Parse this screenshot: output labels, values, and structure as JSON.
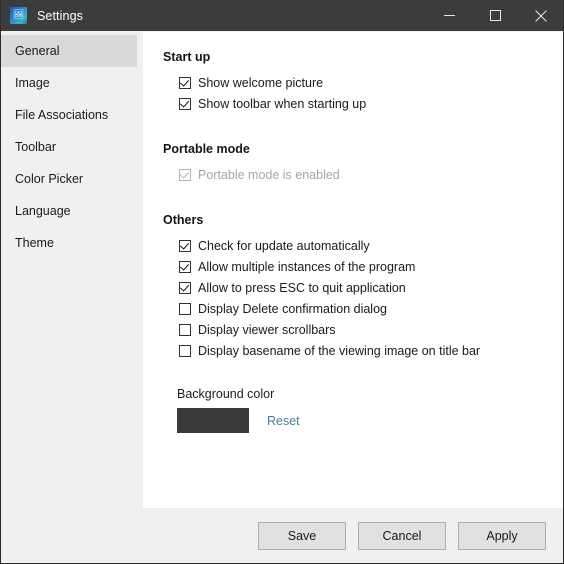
{
  "window": {
    "title": "Settings",
    "app_icon": "image-viewer-icon",
    "controls": {
      "minimize": "minimize-icon",
      "maximize": "maximize-icon",
      "close": "close-icon"
    },
    "titlebar_color": "#3c3c3c"
  },
  "sidebar": {
    "items": [
      {
        "label": "General",
        "selected": true
      },
      {
        "label": "Image",
        "selected": false
      },
      {
        "label": "File Associations",
        "selected": false
      },
      {
        "label": "Toolbar",
        "selected": false
      },
      {
        "label": "Color Picker",
        "selected": false
      },
      {
        "label": "Language",
        "selected": false
      },
      {
        "label": "Theme",
        "selected": false
      }
    ],
    "selected_color": "#d9d9d9",
    "background_color": "#f0f0f0"
  },
  "main": {
    "groups": [
      {
        "title": "Start up",
        "options": [
          {
            "label": "Show welcome picture",
            "checked": true,
            "disabled": false
          },
          {
            "label": "Show toolbar when starting up",
            "checked": true,
            "disabled": false
          }
        ]
      },
      {
        "title": "Portable mode",
        "options": [
          {
            "label": "Portable mode is enabled",
            "checked": true,
            "disabled": true
          }
        ]
      },
      {
        "title": "Others",
        "options": [
          {
            "label": "Check for update automatically",
            "checked": true,
            "disabled": false
          },
          {
            "label": "Allow multiple instances of the program",
            "checked": true,
            "disabled": false
          },
          {
            "label": "Allow to press ESC to quit application",
            "checked": true,
            "disabled": false
          },
          {
            "label": "Display Delete confirmation dialog",
            "checked": false,
            "disabled": false
          },
          {
            "label": "Display viewer scrollbars",
            "checked": false,
            "disabled": false
          },
          {
            "label": "Display basename of the viewing image on title bar",
            "checked": false,
            "disabled": false
          }
        ]
      }
    ],
    "background_color_section": {
      "label": "Background color",
      "swatch_color": "#3a3a3a",
      "reset_label": "Reset",
      "reset_link_color": "#4a7f99"
    }
  },
  "footer": {
    "buttons": [
      {
        "label": "Save"
      },
      {
        "label": "Cancel"
      },
      {
        "label": "Apply"
      }
    ]
  }
}
